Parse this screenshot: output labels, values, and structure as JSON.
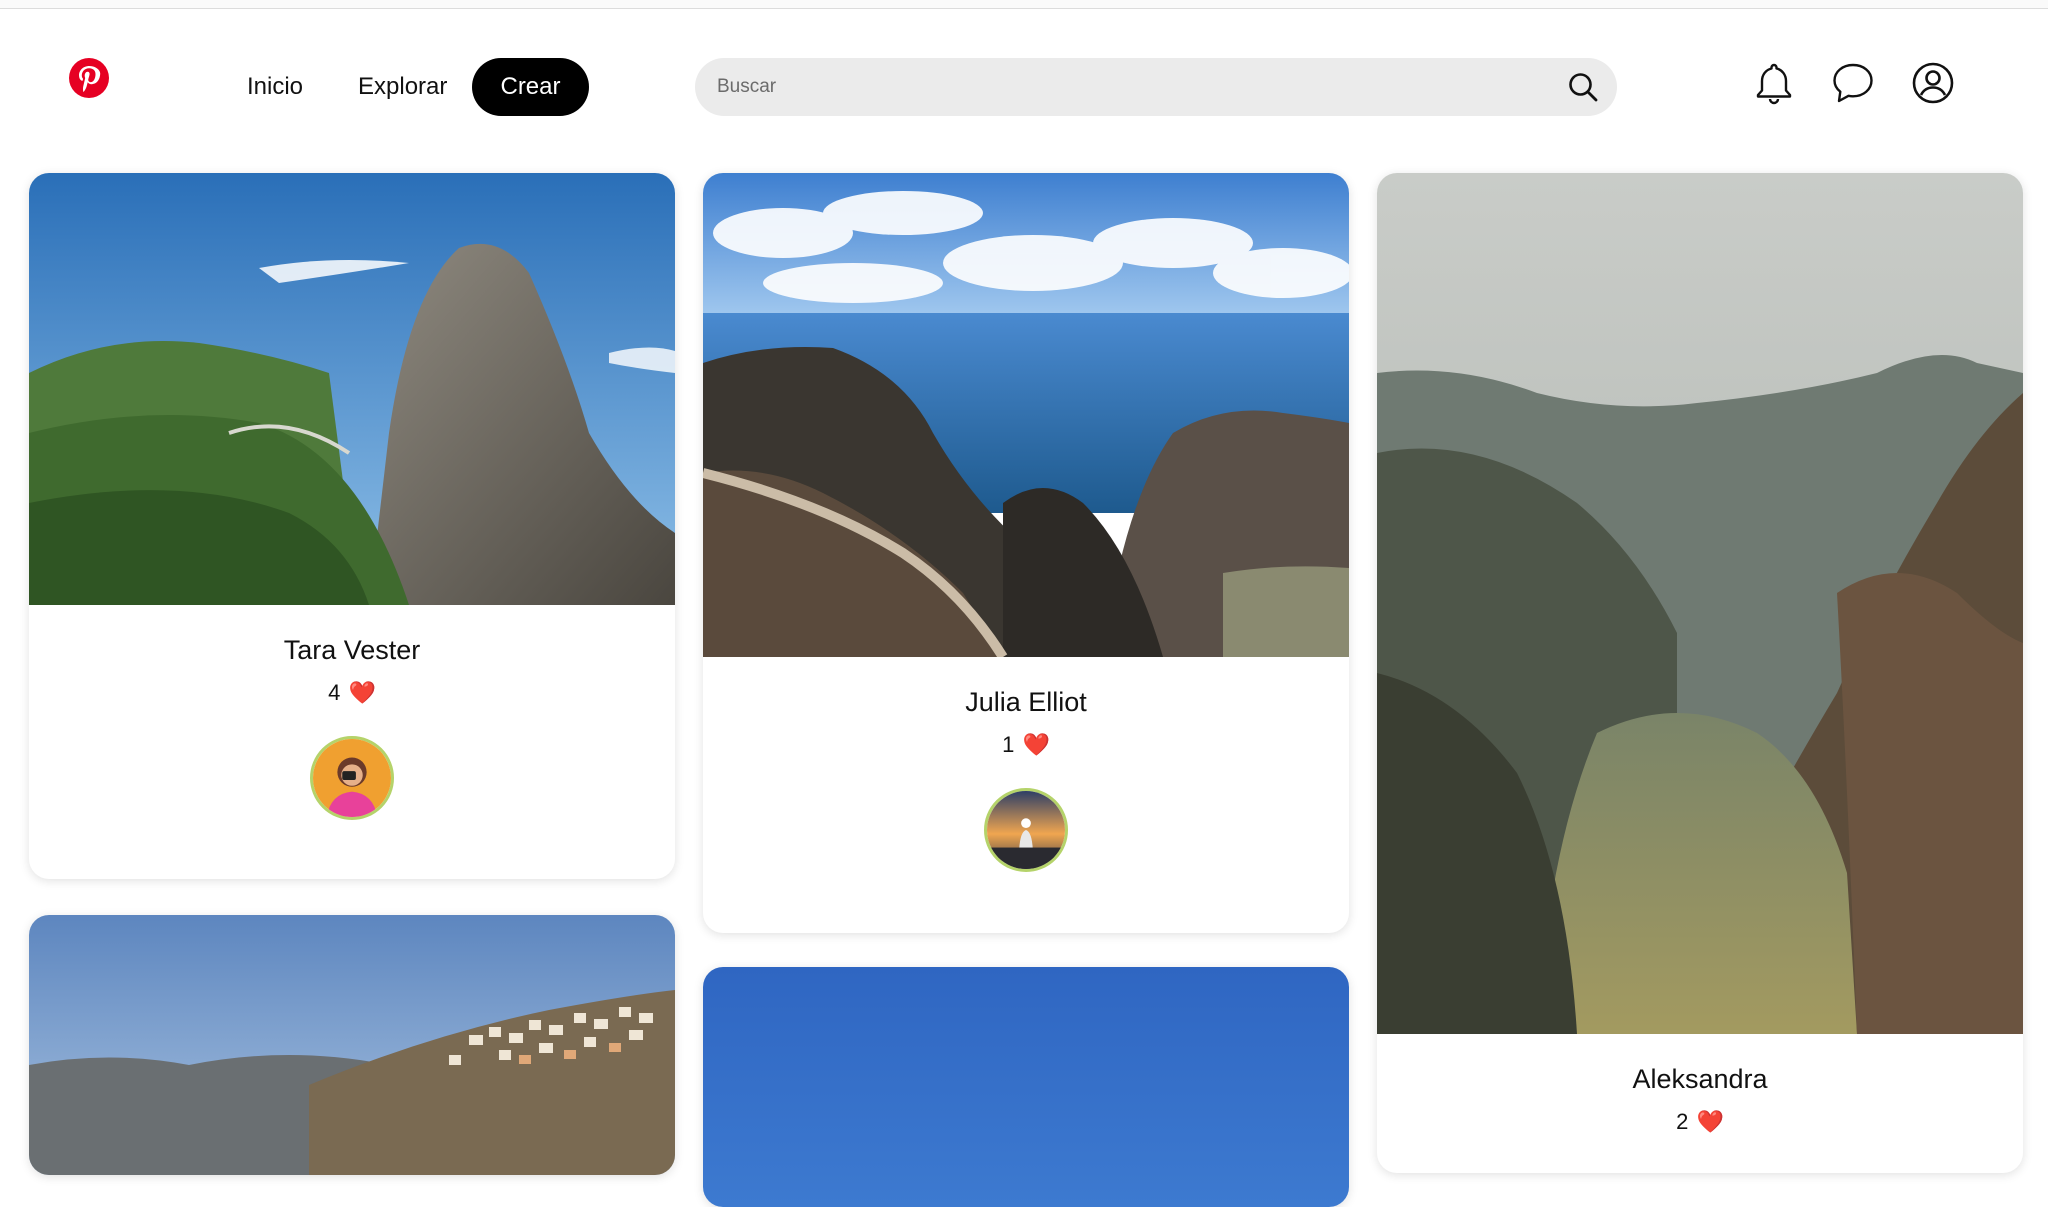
{
  "nav": {
    "inicio": "Inicio",
    "explorar": "Explorar",
    "crear": "Crear"
  },
  "search": {
    "placeholder": "Buscar"
  },
  "header_icons": [
    "pinterest-logo",
    "bell-icon",
    "chat-icon",
    "user-icon"
  ],
  "colors": {
    "brand": "#e60023",
    "active_nav_bg": "#000000",
    "search_bg": "#ebebeb",
    "heart": "#e0282e",
    "avatar_ring": "#b5d36a"
  },
  "pins": [
    {
      "name": "Tara Vester",
      "likes": "4",
      "heart": "❤️"
    },
    {
      "name": "Julia Elliot",
      "likes": "1",
      "heart": "❤️"
    },
    {
      "name": "Aleksandra",
      "likes": "2",
      "heart": "❤️"
    }
  ]
}
